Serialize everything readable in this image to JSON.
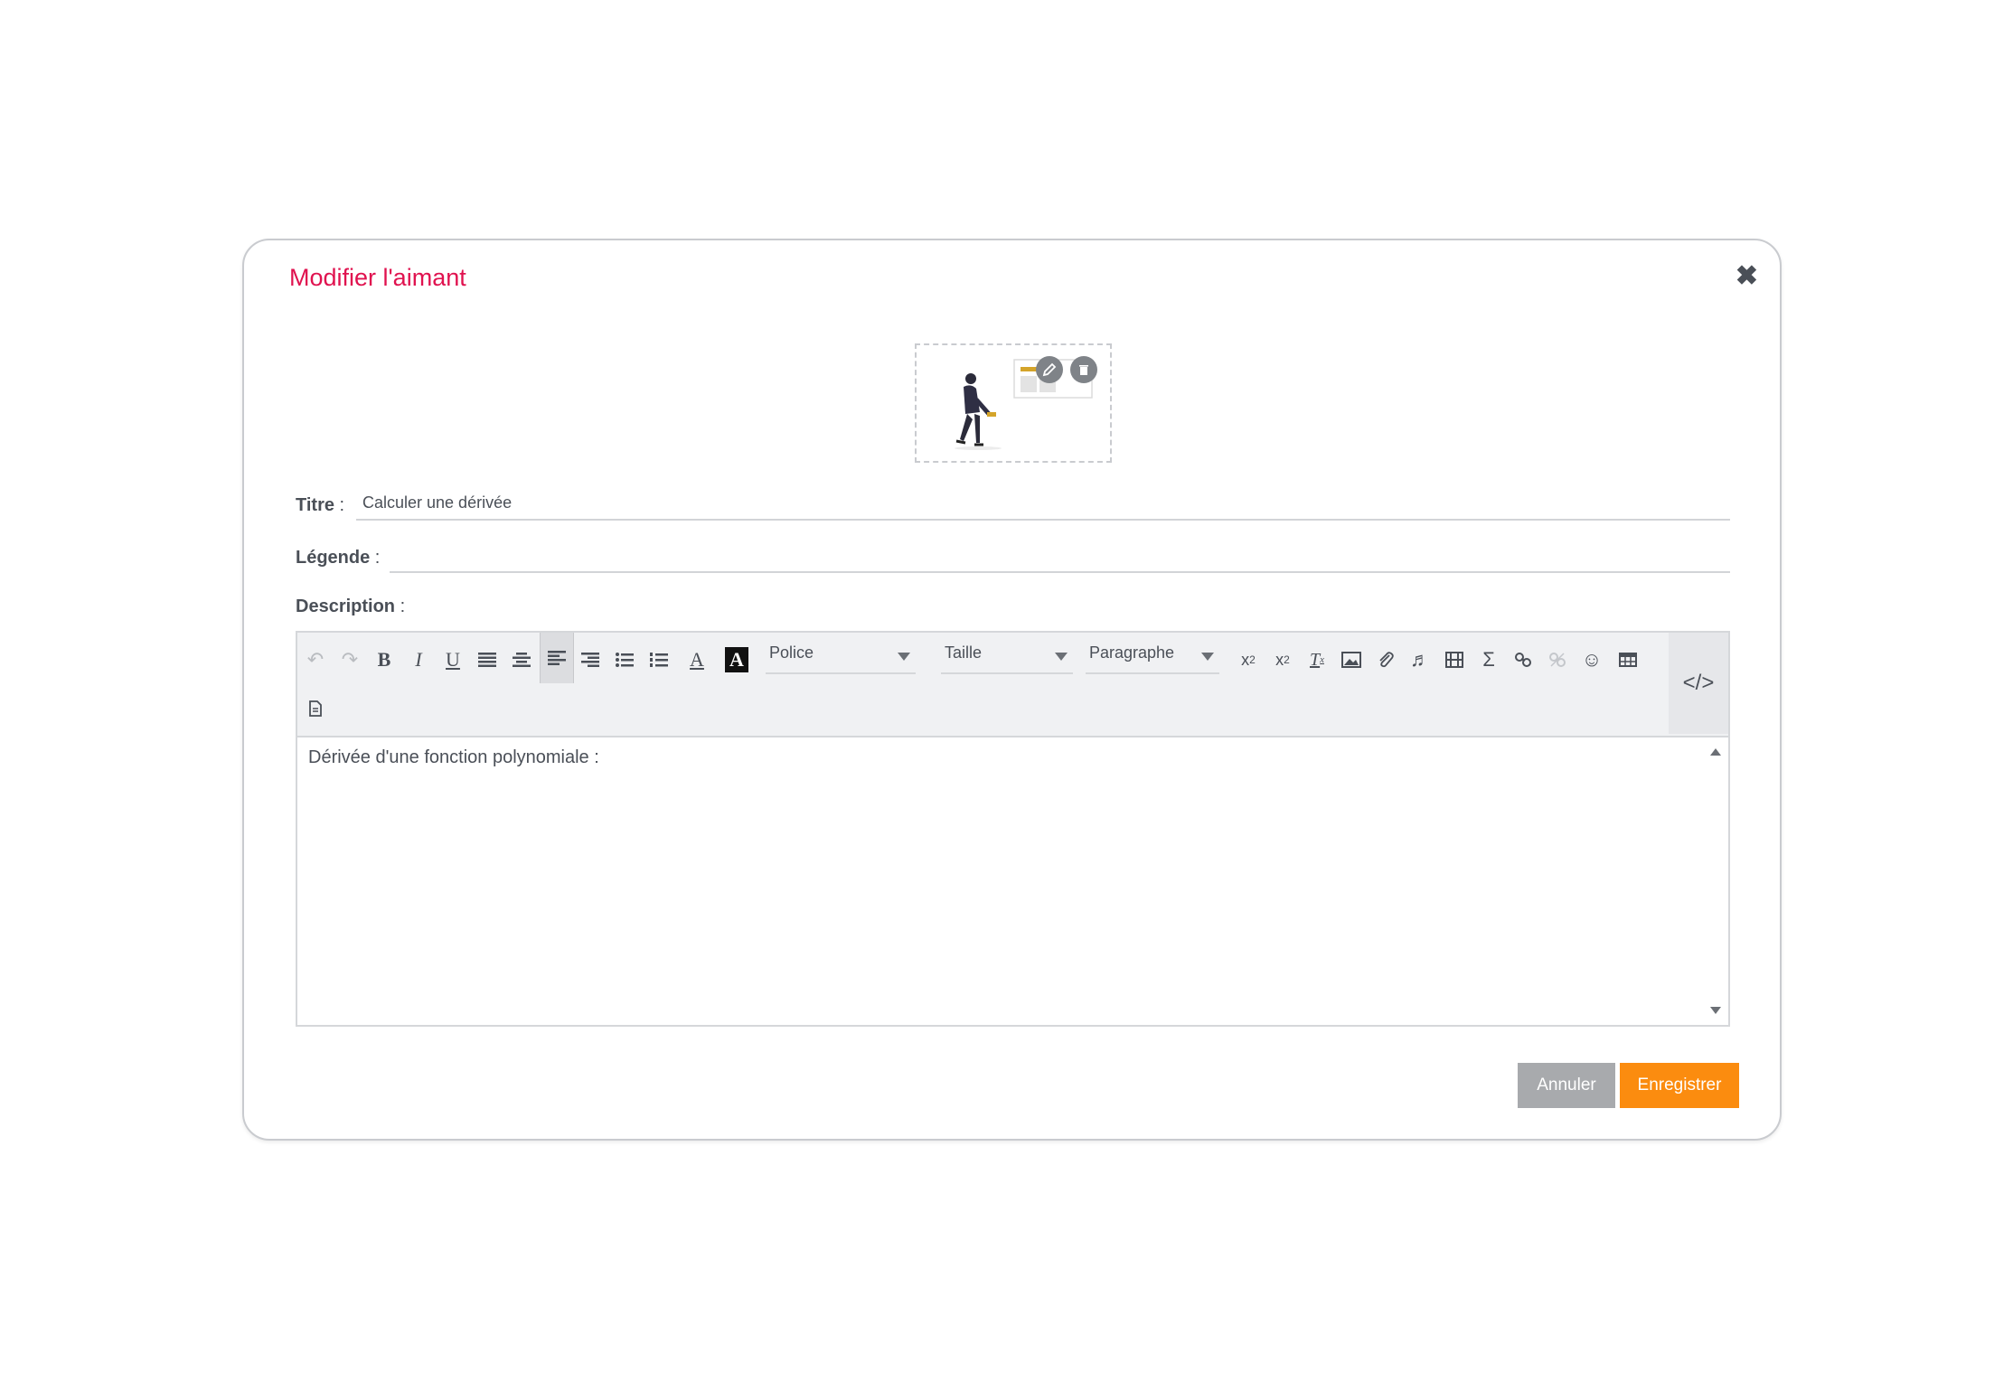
{
  "dialog": {
    "title": "Modifier l'aimant",
    "close_symbol": "✖"
  },
  "image": {
    "edit_icon": "pencil-icon",
    "delete_icon": "trash-icon"
  },
  "fields": {
    "title_label": "Titre",
    "title_sep": " :",
    "title_value": "Calculer une dérivée",
    "caption_label": "Légende",
    "caption_sep": " :",
    "caption_value": "",
    "description_label": "Description",
    "description_sep": " :"
  },
  "toolbar": {
    "font_select": "Police",
    "size_select": "Taille",
    "format_select": "Paragraphe",
    "code_symbol": "</>"
  },
  "editor": {
    "content": "Dérivée d'une fonction polynomiale :"
  },
  "buttons": {
    "cancel": "Annuler",
    "save": "Enregistrer"
  },
  "colors": {
    "title": "#e0124f",
    "save": "#fb8c0f",
    "cancel": "#a8aaad"
  }
}
